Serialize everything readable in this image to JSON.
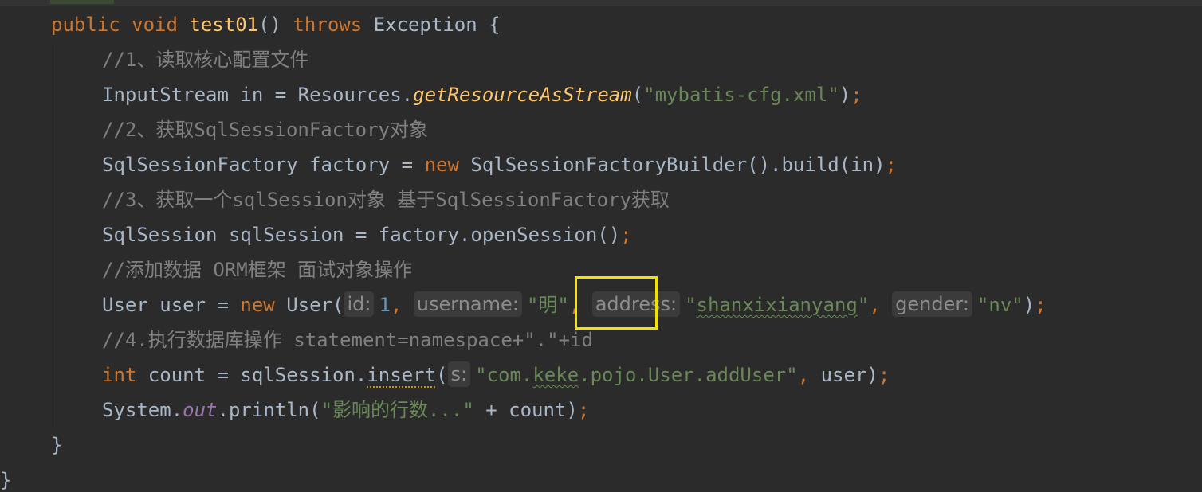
{
  "editor": {
    "lines": [
      {
        "indent": 64,
        "tokens": [
          {
            "t": "public ",
            "c": "kw"
          },
          {
            "t": "void ",
            "c": "kw"
          },
          {
            "t": "test01",
            "c": "fn"
          },
          {
            "t": "() ",
            "c": "plain"
          },
          {
            "t": "throws ",
            "c": "kw"
          },
          {
            "t": "Exception {",
            "c": "plain"
          }
        ]
      },
      {
        "indent": 128,
        "tokens": [
          {
            "t": "//1、读取核心配置文件",
            "c": "cmt"
          }
        ]
      },
      {
        "indent": 128,
        "tokens": [
          {
            "t": "InputStream in = Resources.",
            "c": "plain"
          },
          {
            "t": "getResourceAsStream",
            "c": "it"
          },
          {
            "t": "(",
            "c": "plain"
          },
          {
            "t": "\"mybatis-cfg.xml\"",
            "c": "str"
          },
          {
            "t": ")",
            "c": "plain"
          },
          {
            "t": ";",
            "c": "semi"
          }
        ]
      },
      {
        "indent": 128,
        "tokens": [
          {
            "t": "//2、获取SqlSessionFactory对象",
            "c": "cmt"
          }
        ]
      },
      {
        "indent": 128,
        "tokens": [
          {
            "t": "SqlSessionFactory factory = ",
            "c": "plain"
          },
          {
            "t": "new ",
            "c": "kw"
          },
          {
            "t": "SqlSessionFactoryBuilder().build(in)",
            "c": "plain"
          },
          {
            "t": ";",
            "c": "semi"
          }
        ]
      },
      {
        "indent": 128,
        "tokens": [
          {
            "t": "//3、获取一个sqlSession对象 基于SqlSessionFactory获取",
            "c": "cmt"
          }
        ]
      },
      {
        "indent": 128,
        "tokens": [
          {
            "t": "SqlSession sqlSession = factory.openSession()",
            "c": "plain"
          },
          {
            "t": ";",
            "c": "semi"
          }
        ]
      },
      {
        "indent": 128,
        "tokens": [
          {
            "t": "//添加数据 ORM框架 面试对象操作",
            "c": "cmt"
          }
        ]
      },
      {
        "indent": 128,
        "tokens": [
          {
            "t": "User user = ",
            "c": "plain"
          },
          {
            "t": "new ",
            "c": "kw"
          },
          {
            "t": "User(",
            "c": "plain"
          },
          {
            "t": "id:",
            "c": "hint"
          },
          {
            "t": "1",
            "c": "num"
          },
          {
            "t": ", ",
            "c": "semi"
          },
          {
            "t": "username:",
            "c": "hint"
          },
          {
            "t": "\"明\"",
            "c": "str"
          },
          {
            "t": ", ",
            "c": "semi"
          },
          {
            "t": "address:",
            "c": "hint"
          },
          {
            "t": "\"",
            "c": "str"
          },
          {
            "t": "shanxixianyang",
            "c": "str squig"
          },
          {
            "t": "\"",
            "c": "str"
          },
          {
            "t": ", ",
            "c": "semi"
          },
          {
            "t": "gender:",
            "c": "hint"
          },
          {
            "t": "\"nv\"",
            "c": "str"
          },
          {
            "t": ")",
            "c": "plain"
          },
          {
            "t": ";",
            "c": "semi"
          }
        ]
      },
      {
        "indent": 128,
        "tokens": [
          {
            "t": "//4.执行数据库操作 statement=namespace+\".\"+id",
            "c": "cmt"
          }
        ]
      },
      {
        "indent": 128,
        "tokens": [
          {
            "t": "int ",
            "c": "kw"
          },
          {
            "t": "count = sqlSession.",
            "c": "plain"
          },
          {
            "t": "insert",
            "c": "plain warn"
          },
          {
            "t": "(",
            "c": "plain"
          },
          {
            "t": "s:",
            "c": "hint"
          },
          {
            "t": "\"com.",
            "c": "str"
          },
          {
            "t": "keke",
            "c": "str squig"
          },
          {
            "t": ".pojo.User.addUser\"",
            "c": "str"
          },
          {
            "t": ", ",
            "c": "semi"
          },
          {
            "t": "user)",
            "c": "plain"
          },
          {
            "t": ";",
            "c": "semi"
          }
        ]
      },
      {
        "indent": 128,
        "tokens": [
          {
            "t": "System.",
            "c": "plain"
          },
          {
            "t": "out",
            "c": "field"
          },
          {
            "t": ".println(",
            "c": "plain"
          },
          {
            "t": "\"影响的行数...\"",
            "c": "str"
          },
          {
            "t": " + count)",
            "c": "plain"
          },
          {
            "t": ";",
            "c": "semi"
          }
        ]
      },
      {
        "indent": 64,
        "tokens": [
          {
            "t": "}",
            "c": "plain"
          }
        ]
      },
      {
        "indent": 0,
        "tokens": [
          {
            "t": "}",
            "c": "plain"
          }
        ]
      }
    ]
  },
  "colors": {
    "background": "#2b2b2b",
    "keyword": "#cc7832",
    "method_declaration": "#ffc66d",
    "identifier": "#a9b7c6",
    "comment": "#808080",
    "string": "#6a8759",
    "number": "#6897bb",
    "static_field": "#9876aa",
    "inlay_hint_bg": "#3b3b3b",
    "highlight_box": "#f5e100"
  }
}
